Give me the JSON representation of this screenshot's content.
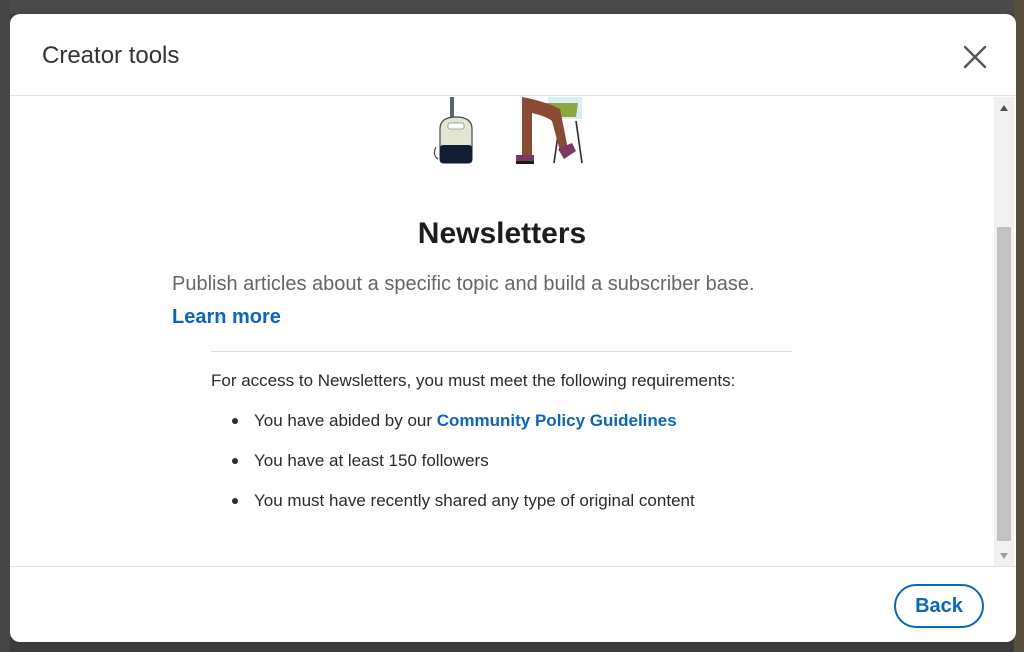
{
  "modal": {
    "title": "Creator tools",
    "close_icon": "close-icon"
  },
  "feature": {
    "illustration_icon": "newsletter-illustration",
    "title": "Newsletters",
    "description": "Publish articles about a specific topic and build a subscriber base.",
    "learn_more_label": "Learn more"
  },
  "requirements": {
    "intro": "For access to Newsletters, you must meet the following requirements:",
    "items": {
      "policy": {
        "prefix": "You have abided by our ",
        "link_label": "Community Policy Guidelines"
      },
      "followers": "You have at least 150 followers",
      "content": "You must have recently shared any type of original content"
    }
  },
  "footer": {
    "back_label": "Back"
  },
  "colors": {
    "accent": "#0a66c2",
    "title_text": "#1d1d1d",
    "muted_text": "#666666",
    "overlay": "#3b3b3b"
  }
}
